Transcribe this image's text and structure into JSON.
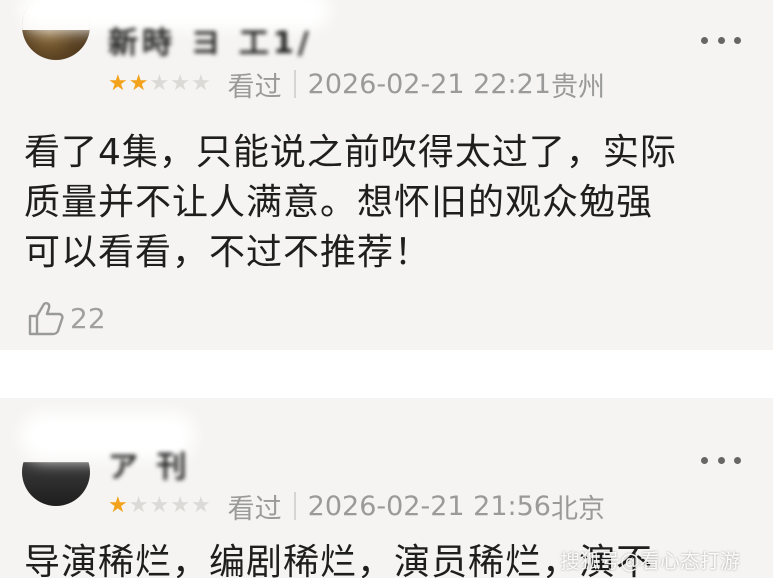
{
  "reviews": [
    {
      "username": "新時 ヨ 工1/",
      "rating_text": "2/5",
      "stars": [
        "★",
        "★",
        "★",
        "★",
        "★"
      ],
      "status": "看过",
      "datetime": "2026-02-21 22:21",
      "location": "贵州",
      "comment_lines": [
        "看了4集，只能说之前吹得太过了，实际",
        "质量并不让人满意。想怀旧的观众勉强",
        "可以看看，不过不推荐！"
      ],
      "likes": "22"
    },
    {
      "username": "ア 刊",
      "rating_text": "1/5",
      "stars": [
        "★",
        "★",
        "★",
        "★",
        "★"
      ],
      "status": "看过",
      "datetime": "2026-02-21 21:56",
      "location": "北京",
      "comment_lines": [
        "导演稀烂，编剧稀烂，演员稀烂，演不"
      ]
    }
  ],
  "watermark": "搜狐号@看心态打游",
  "colors": {
    "star_on": "#f3a21b",
    "star_off": "#dcdad6",
    "card_bg": "#f5f4f2",
    "meta_gray": "#9a9a9a"
  },
  "icons": [
    "more-icon",
    "star-icon",
    "thumbs-up-icon"
  ]
}
